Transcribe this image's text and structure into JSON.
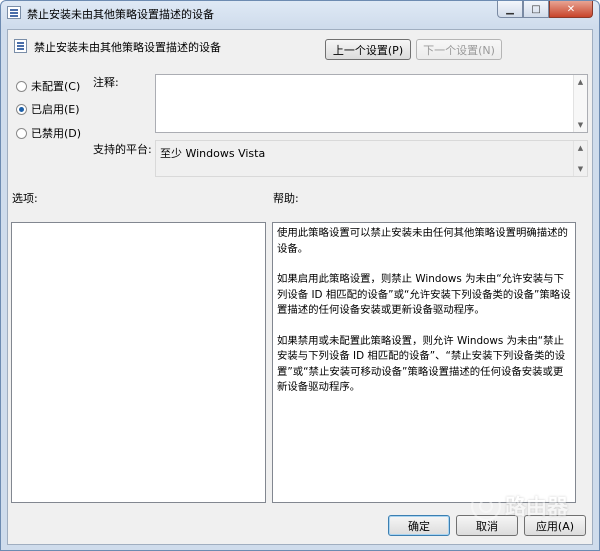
{
  "window": {
    "title": "禁止安装未由其他策略设置描述的设备"
  },
  "caption": {
    "minimize": "▁",
    "maximize": "□",
    "close": "✕"
  },
  "header": {
    "title": "禁止安装未由其他策略设置描述的设备"
  },
  "nav": {
    "prev_label": "上一个设置(P)",
    "next_label": "下一个设置(N)"
  },
  "state": {
    "options": [
      {
        "label": "未配置(C)",
        "selected": false
      },
      {
        "label": "已启用(E)",
        "selected": true
      },
      {
        "label": "已禁用(D)",
        "selected": false
      }
    ]
  },
  "comment": {
    "label": "注释:",
    "value": ""
  },
  "platform": {
    "label": "支持的平台:",
    "value": "至少 Windows Vista"
  },
  "options_section": {
    "label": "选项:"
  },
  "help_section": {
    "label": "帮助:",
    "paragraphs": [
      "使用此策略设置可以禁止安装未由任何其他策略设置明确描述的设备。",
      "如果启用此策略设置，则禁止 Windows 为未由“允许安装与下列设备 ID 相匹配的设备”或“允许安装下列设备类的设备”策略设置描述的任何设备安装或更新设备驱动程序。",
      "如果禁用或未配置此策略设置，则允许 Windows 为未由“禁止安装与下列设备 ID 相匹配的设备”、“禁止安装下列设备类的设置”或“禁止安装可移动设备”策略设置描述的任何设备安装或更新设备驱动程序。"
    ]
  },
  "footer": {
    "ok_label": "确定",
    "cancel_label": "取消",
    "apply_label": "应用(A)"
  },
  "watermark": {
    "text": "路由器"
  }
}
